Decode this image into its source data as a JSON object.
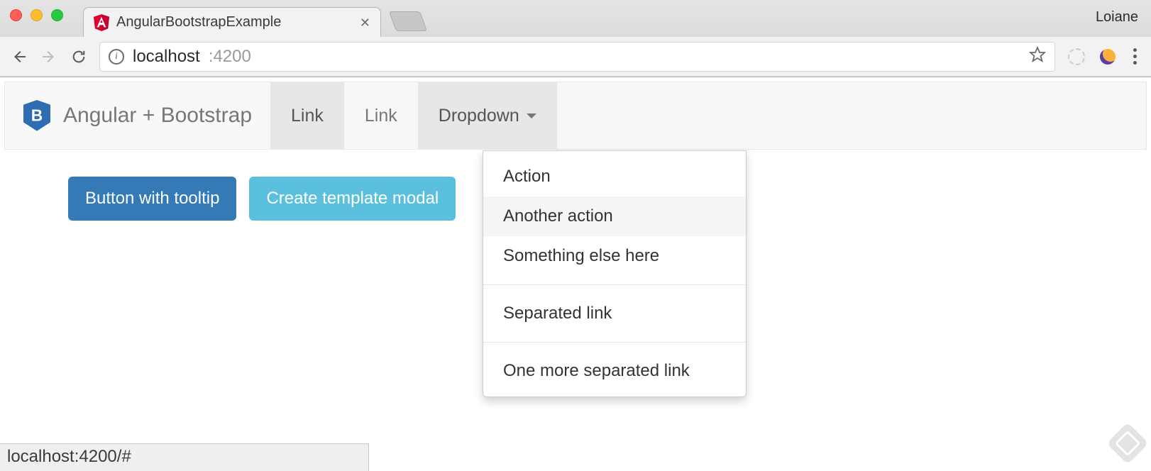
{
  "browser": {
    "tab_title": "AngularBootstrapExample",
    "profile_name": "Loiane",
    "url_host": "localhost",
    "url_port": ":4200",
    "status_bar": "localhost:4200/#"
  },
  "navbar": {
    "brand": "Angular + Bootstrap",
    "items": [
      {
        "label": "Link"
      },
      {
        "label": "Link"
      },
      {
        "label": "Dropdown"
      }
    ]
  },
  "dropdown": {
    "items": [
      "Action",
      "Another action",
      "Something else here",
      "Separated link",
      "One more separated link"
    ]
  },
  "buttons": {
    "tooltip_btn": "Button with tooltip",
    "modal_btn": "Create template modal"
  }
}
